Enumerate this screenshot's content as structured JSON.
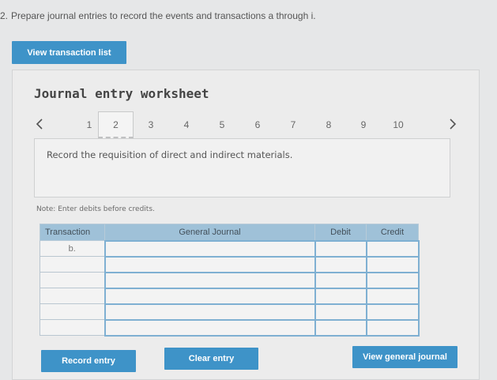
{
  "question": {
    "number": "2.",
    "text": "Prepare journal entries to record the events and transactions a through i."
  },
  "buttons": {
    "view_transaction_list": "View transaction list",
    "record_entry": "Record entry",
    "clear_entry": "Clear entry",
    "view_general_journal": "View general journal"
  },
  "worksheet": {
    "title": "Journal entry worksheet",
    "pages": [
      "1",
      "2",
      "3",
      "4",
      "5",
      "6",
      "7",
      "8",
      "9",
      "10"
    ],
    "active_page": "2",
    "instruction": "Record the requisition of direct and indirect materials.",
    "note": "Note: Enter debits before credits."
  },
  "table": {
    "headers": {
      "transaction": "Transaction",
      "general_journal": "General Journal",
      "debit": "Debit",
      "credit": "Credit"
    },
    "rows": [
      {
        "transaction": "b.",
        "account": "",
        "debit": "",
        "credit": ""
      },
      {
        "transaction": "",
        "account": "",
        "debit": "",
        "credit": ""
      },
      {
        "transaction": "",
        "account": "",
        "debit": "",
        "credit": ""
      },
      {
        "transaction": "",
        "account": "",
        "debit": "",
        "credit": ""
      },
      {
        "transaction": "",
        "account": "",
        "debit": "",
        "credit": ""
      },
      {
        "transaction": "",
        "account": "",
        "debit": "",
        "credit": ""
      }
    ]
  },
  "colors": {
    "button": "#3e93c8",
    "table_header": "#9fc1d8",
    "input_border": "#7fb0d2"
  }
}
